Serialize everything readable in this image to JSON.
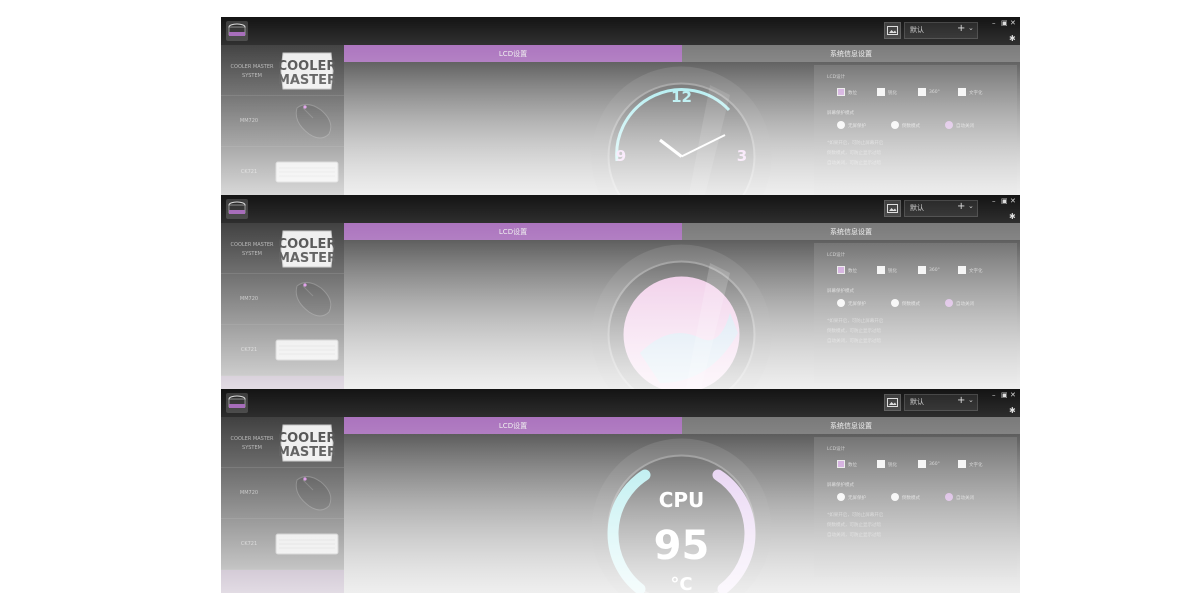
{
  "app": {
    "tab_lcd": "LCD设置",
    "tab_system": "系统信息设置",
    "profile_name": "默认",
    "profile_add": "+",
    "profile_dropdown": "⌄",
    "window_minimize": "–",
    "window_restore": "▣",
    "window_close": "✕",
    "settings_icon": "✱",
    "sidebar": [
      {
        "label": "COOLER MASTER\nSYSTEM",
        "icon": "cooler-master-logo"
      },
      {
        "label": "MM720",
        "icon": "mouse-icon"
      },
      {
        "label": "CK721",
        "icon": "keyboard-icon"
      }
    ],
    "panel": {
      "title": "LCD设计",
      "display_options": [
        "数位",
        "锐化",
        "360°",
        "文字化"
      ],
      "selected_display": 0,
      "mode_title": "屏幕保护模式",
      "mode_options": [
        "无屏保护",
        "倒数模式",
        "自动关闭"
      ],
      "selected_mode": 2,
      "hints": [
        "*如果开启，可防止屏幕开启",
        "倒数模式，可防止显示过暗",
        "自动关闭，可防止显示过暗"
      ]
    },
    "accent_color": "#a163b6"
  },
  "frames": [
    {
      "display": "clock",
      "clock_numbers": [
        "12",
        "3",
        "9"
      ]
    },
    {
      "display": "image"
    },
    {
      "display": "cpu",
      "cpu_label": "CPU",
      "cpu_value": "95",
      "cpu_unit": "°C"
    }
  ]
}
